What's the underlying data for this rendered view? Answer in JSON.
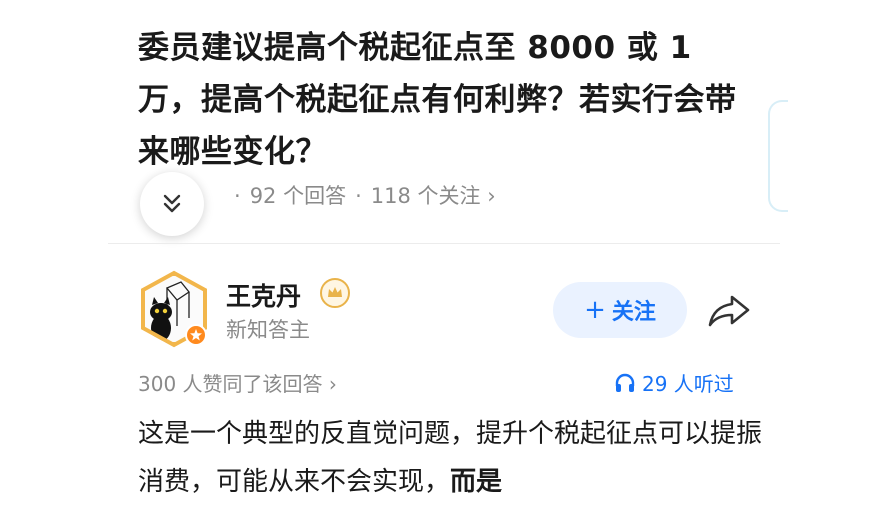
{
  "question": {
    "title": "委员建议提高个税起征点至 8000 或 1 万，提高个税起征点有何利弊？若实行会带来哪些变化？",
    "answers": "92 个回答",
    "followers": "118 个关注",
    "meta_chevron": "›"
  },
  "author": {
    "name": "王克丹",
    "subtitle": "新知答主",
    "follow_label": "关注",
    "follow_plus": "+"
  },
  "stats": {
    "agree": "300 人赞同了该回答 ›",
    "listen": "29 人听过"
  },
  "answer": {
    "text": "这是一个典型的反直觉问题，提升个税起征点可以提振消费，可能从来不会实现，",
    "bold": "而是"
  },
  "icons": [
    "chevron-double-down-icon",
    "crown-icon",
    "share-icon",
    "headphones-icon",
    "verified-badge-icon"
  ],
  "colors": {
    "accent": "#1772f6",
    "follow_bg": "#eaf2ff",
    "muted": "#8a8a8a"
  }
}
